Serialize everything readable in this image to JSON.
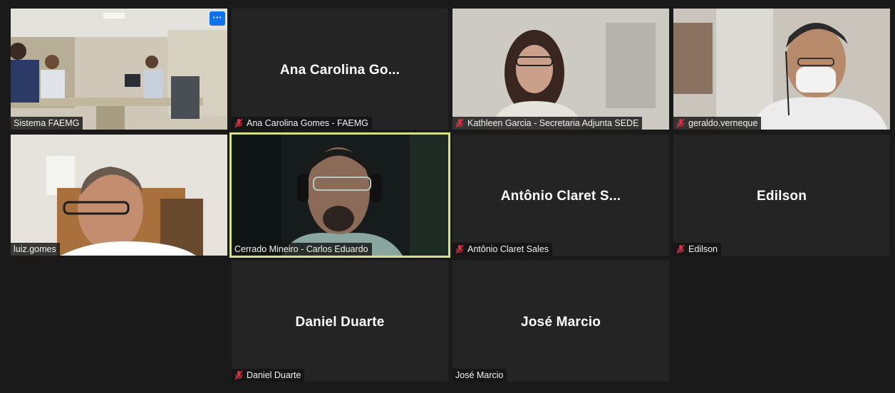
{
  "window": {
    "app": "Zoom meeting gallery view"
  },
  "tiles": [
    {
      "big_name": "",
      "label": "Sistema FAEMG",
      "muted": false,
      "video": true
    },
    {
      "big_name": "Ana Carolina Go...",
      "label": "Ana Carolina Gomes - FAEMG",
      "muted": true,
      "video": false
    },
    {
      "big_name": "",
      "label": "Kathleen Garcia - Secretaria Adjunta SEDE",
      "muted": true,
      "video": true
    },
    {
      "big_name": "",
      "label": "geraldo.verneque",
      "muted": true,
      "video": true
    },
    {
      "big_name": "",
      "label": "luiz.gomes",
      "muted": false,
      "video": true
    },
    {
      "big_name": "",
      "label": "Cerrado Mineiro - Carlos Eduardo",
      "muted": false,
      "video": true,
      "active_speaker": true
    },
    {
      "big_name": "Antônio Claret S...",
      "label": "Antônio Claret Sales",
      "muted": true,
      "video": false
    },
    {
      "big_name": "Edilson",
      "label": "Edilson",
      "muted": true,
      "video": false
    },
    {
      "big_name": "Daniel Duarte",
      "label": "Daniel Duarte",
      "muted": true,
      "video": false
    },
    {
      "big_name": "José Marcio",
      "label": "José Marcio",
      "muted": false,
      "video": false
    }
  ],
  "more_button": {
    "label": "···",
    "icon": "more-options-icon"
  },
  "colors": {
    "background": "#1a1a1a",
    "tile": "#242424",
    "active_border": "#d6e08a",
    "muted_icon": "#e02f44",
    "accent": "#0e72ed"
  }
}
